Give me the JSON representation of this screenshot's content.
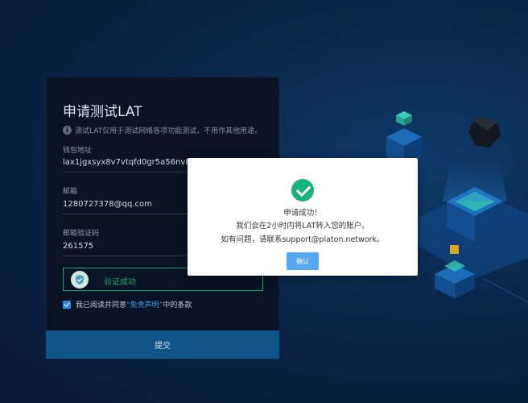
{
  "form": {
    "title": "申请测试LAT",
    "notice": "测试LAT仅用于测试网络各项功能测试，不用作其他用途。",
    "wallet_label": "钱包地址",
    "wallet_value": "lax1jgxsyx8v7vtqfd0gr5a56nv876uj9",
    "email_label": "邮箱",
    "email_value": "1280727378@qq.com",
    "code_label": "邮箱验证码",
    "code_value": "261575",
    "verify_status": "验证成功",
    "agree_prefix": "我已阅读并同意",
    "agree_link": "“免责声明”",
    "agree_suffix": "中的条款",
    "submit_label": "提交"
  },
  "modal": {
    "line1": "申请成功！",
    "line2": "我们会在2小时内将LAT转入您的账户。",
    "line3": "如有问题，请联系support@platon.network。",
    "confirm_label": "确认"
  },
  "colors": {
    "success": "#1ab27a",
    "primary": "#56a8f0",
    "submit": "#11548a"
  },
  "icons": {
    "info": "info-icon",
    "shield": "shield-icon",
    "checkbox": "checkbox-checked",
    "success": "check-circle-icon"
  }
}
